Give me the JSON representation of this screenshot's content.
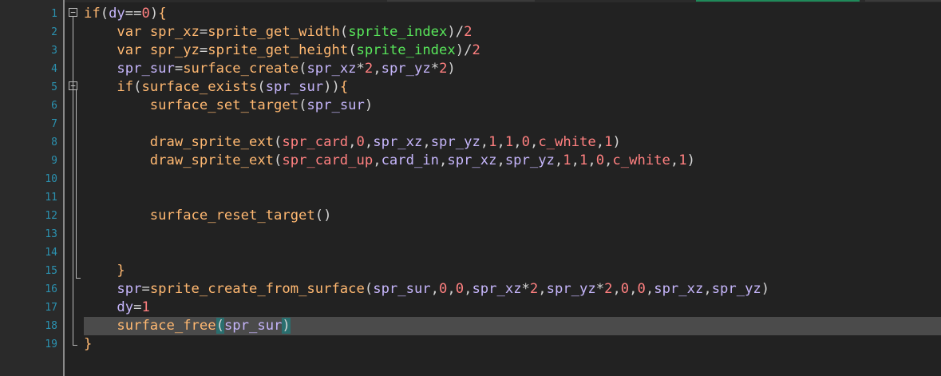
{
  "colors": {
    "editor_bg": "#222222",
    "gutter_bg": "#2a2a2a",
    "line_number": "#2b91af",
    "keyword": "#ffb871",
    "variable": "#c5b5fa",
    "function": "#ffb871",
    "number": "#ff8080",
    "resource": "#58e55a",
    "current_line_bg": "#4b4b4b",
    "bracket_match_bg": "#2a6f6f"
  },
  "editor": {
    "current_line": 18,
    "lines": [
      {
        "num": "1",
        "tokens": [
          [
            "kw",
            "if"
          ],
          [
            "pun",
            "("
          ],
          [
            "var",
            "dy"
          ],
          [
            "op",
            "=="
          ],
          [
            "num",
            "0"
          ],
          [
            "pun",
            ")"
          ],
          [
            "kw",
            "{"
          ]
        ]
      },
      {
        "num": "2",
        "tokens": [
          [
            "ws",
            "    "
          ],
          [
            "kw",
            "var"
          ],
          [
            "ws",
            " "
          ],
          [
            "plain",
            "spr_xz"
          ],
          [
            "op",
            "="
          ],
          [
            "fn",
            "sprite_get_width"
          ],
          [
            "pun",
            "("
          ],
          [
            "res",
            "sprite_index"
          ],
          [
            "pun",
            ")"
          ],
          [
            "op",
            "/"
          ],
          [
            "num",
            "2"
          ]
        ]
      },
      {
        "num": "3",
        "tokens": [
          [
            "ws",
            "    "
          ],
          [
            "kw",
            "var"
          ],
          [
            "ws",
            " "
          ],
          [
            "plain",
            "spr_yz"
          ],
          [
            "op",
            "="
          ],
          [
            "fn",
            "sprite_get_height"
          ],
          [
            "pun",
            "("
          ],
          [
            "res",
            "sprite_index"
          ],
          [
            "pun",
            ")"
          ],
          [
            "op",
            "/"
          ],
          [
            "num",
            "2"
          ]
        ]
      },
      {
        "num": "4",
        "tokens": [
          [
            "ws",
            "    "
          ],
          [
            "var",
            "spr_sur"
          ],
          [
            "op",
            "="
          ],
          [
            "fn",
            "surface_create"
          ],
          [
            "pun",
            "("
          ],
          [
            "var",
            "spr_xz"
          ],
          [
            "op",
            "*"
          ],
          [
            "num",
            "2"
          ],
          [
            "pun",
            ","
          ],
          [
            "var",
            "spr_yz"
          ],
          [
            "op",
            "*"
          ],
          [
            "num",
            "2"
          ],
          [
            "pun",
            ")"
          ]
        ]
      },
      {
        "num": "5",
        "tokens": [
          [
            "ws",
            "    "
          ],
          [
            "kw",
            "if"
          ],
          [
            "pun",
            "("
          ],
          [
            "fn",
            "surface_exists"
          ],
          [
            "pun",
            "("
          ],
          [
            "var",
            "spr_sur"
          ],
          [
            "pun",
            "))"
          ],
          [
            "kw",
            "{"
          ]
        ]
      },
      {
        "num": "6",
        "tokens": [
          [
            "ws",
            "        "
          ],
          [
            "fn",
            "surface_set_target"
          ],
          [
            "pun",
            "("
          ],
          [
            "var",
            "spr_sur"
          ],
          [
            "pun",
            ")"
          ]
        ]
      },
      {
        "num": "7",
        "tokens": []
      },
      {
        "num": "8",
        "tokens": [
          [
            "ws",
            "        "
          ],
          [
            "fn",
            "draw_sprite_ext"
          ],
          [
            "pun",
            "("
          ],
          [
            "asset",
            "spr_card"
          ],
          [
            "pun",
            ","
          ],
          [
            "num",
            "0"
          ],
          [
            "pun",
            ","
          ],
          [
            "var",
            "spr_xz"
          ],
          [
            "pun",
            ","
          ],
          [
            "var",
            "spr_yz"
          ],
          [
            "pun",
            ","
          ],
          [
            "num",
            "1"
          ],
          [
            "pun",
            ","
          ],
          [
            "num",
            "1"
          ],
          [
            "pun",
            ","
          ],
          [
            "num",
            "0"
          ],
          [
            "pun",
            ","
          ],
          [
            "const",
            "c_white"
          ],
          [
            "pun",
            ","
          ],
          [
            "num",
            "1"
          ],
          [
            "pun",
            ")"
          ]
        ]
      },
      {
        "num": "9",
        "tokens": [
          [
            "ws",
            "        "
          ],
          [
            "fn",
            "draw_sprite_ext"
          ],
          [
            "pun",
            "("
          ],
          [
            "asset",
            "spr_card_up"
          ],
          [
            "pun",
            ","
          ],
          [
            "var",
            "card_in"
          ],
          [
            "pun",
            ","
          ],
          [
            "var",
            "spr_xz"
          ],
          [
            "pun",
            ","
          ],
          [
            "var",
            "spr_yz"
          ],
          [
            "pun",
            ","
          ],
          [
            "num",
            "1"
          ],
          [
            "pun",
            ","
          ],
          [
            "num",
            "1"
          ],
          [
            "pun",
            ","
          ],
          [
            "num",
            "0"
          ],
          [
            "pun",
            ","
          ],
          [
            "const",
            "c_white"
          ],
          [
            "pun",
            ","
          ],
          [
            "num",
            "1"
          ],
          [
            "pun",
            ")"
          ]
        ]
      },
      {
        "num": "10",
        "tokens": []
      },
      {
        "num": "11",
        "tokens": []
      },
      {
        "num": "12",
        "tokens": [
          [
            "ws",
            "        "
          ],
          [
            "fn",
            "surface_reset_target"
          ],
          [
            "pun",
            "()"
          ]
        ]
      },
      {
        "num": "13",
        "tokens": []
      },
      {
        "num": "14",
        "tokens": []
      },
      {
        "num": "15",
        "tokens": [
          [
            "ws",
            "    "
          ],
          [
            "kw",
            "}"
          ]
        ]
      },
      {
        "num": "16",
        "tokens": [
          [
            "ws",
            "    "
          ],
          [
            "var",
            "spr"
          ],
          [
            "op",
            "="
          ],
          [
            "fn",
            "sprite_create_from_surface"
          ],
          [
            "pun",
            "("
          ],
          [
            "var",
            "spr_sur"
          ],
          [
            "pun",
            ","
          ],
          [
            "num",
            "0"
          ],
          [
            "pun",
            ","
          ],
          [
            "num",
            "0"
          ],
          [
            "pun",
            ","
          ],
          [
            "var",
            "spr_xz"
          ],
          [
            "op",
            "*"
          ],
          [
            "num",
            "2"
          ],
          [
            "pun",
            ","
          ],
          [
            "var",
            "spr_yz"
          ],
          [
            "op",
            "*"
          ],
          [
            "num",
            "2"
          ],
          [
            "pun",
            ","
          ],
          [
            "num",
            "0"
          ],
          [
            "pun",
            ","
          ],
          [
            "num",
            "0"
          ],
          [
            "pun",
            ","
          ],
          [
            "var",
            "spr_xz"
          ],
          [
            "pun",
            ","
          ],
          [
            "var",
            "spr_yz"
          ],
          [
            "pun",
            ")"
          ]
        ]
      },
      {
        "num": "17",
        "tokens": [
          [
            "ws",
            "    "
          ],
          [
            "var",
            "dy"
          ],
          [
            "op",
            "="
          ],
          [
            "num",
            "1"
          ]
        ]
      },
      {
        "num": "18",
        "tokens": [
          [
            "ws",
            "    "
          ],
          [
            "fn",
            "surface_free"
          ],
          [
            "hl",
            "("
          ],
          [
            "var",
            "spr_sur"
          ],
          [
            "hl",
            ")"
          ]
        ]
      },
      {
        "num": "19",
        "tokens": [
          [
            "kw",
            "}"
          ]
        ]
      }
    ]
  }
}
